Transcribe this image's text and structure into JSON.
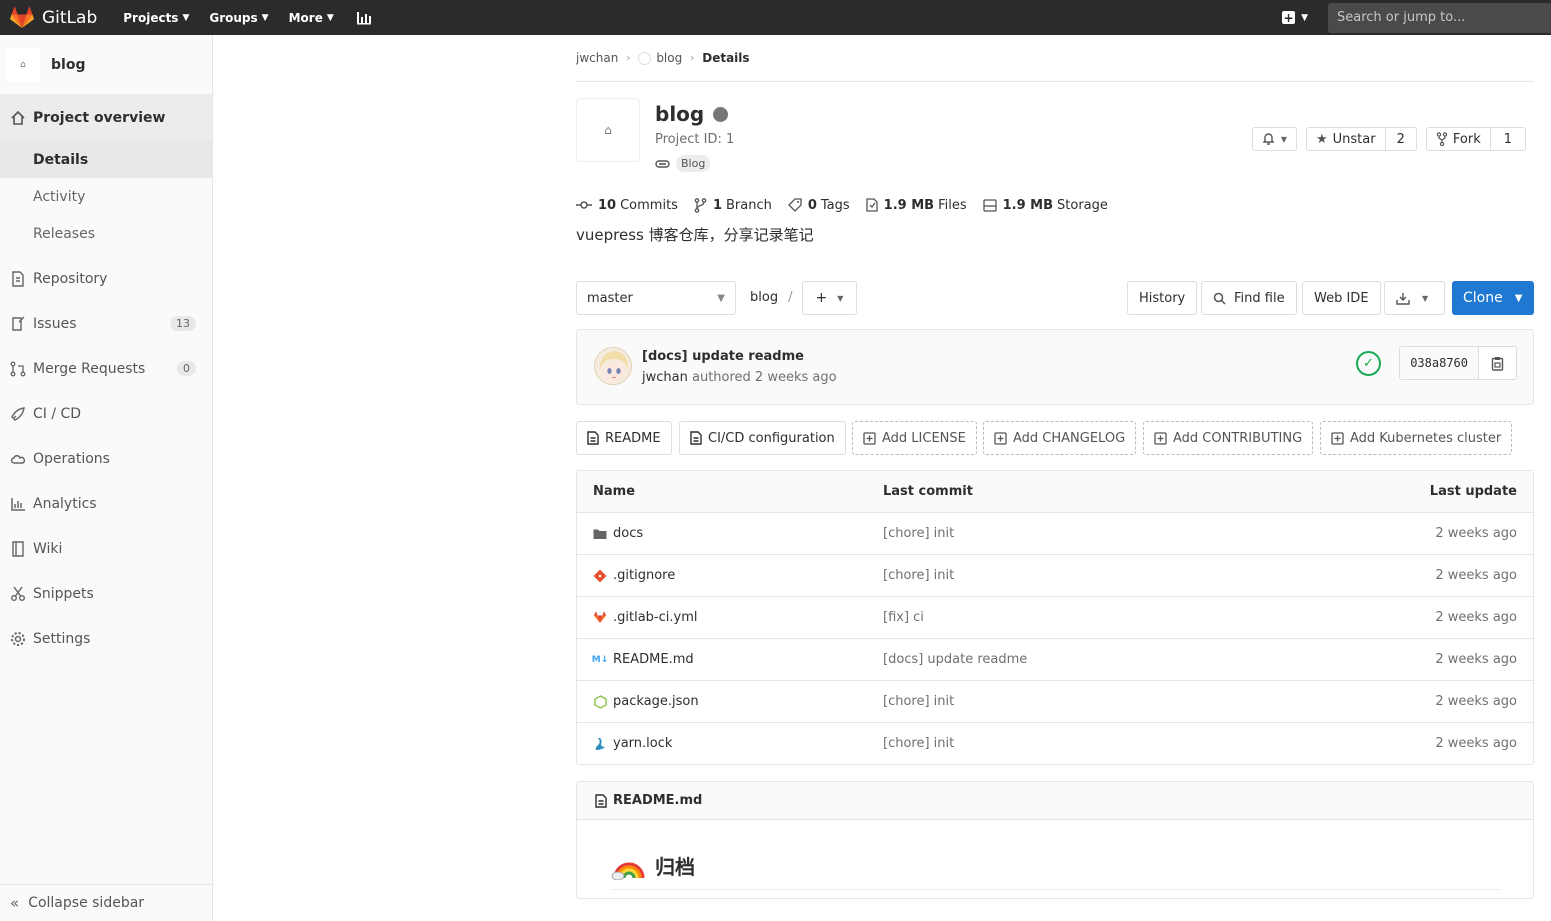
{
  "navbar": {
    "logo": "GitLab",
    "items": [
      {
        "label": "Projects"
      },
      {
        "label": "Groups"
      },
      {
        "label": "More"
      }
    ],
    "search_placeholder": "Search or jump to..."
  },
  "sidebar": {
    "project_avatar_text": "⌂",
    "project_name": "blog",
    "overview": "Project overview",
    "subitems": [
      "Details",
      "Activity",
      "Releases"
    ],
    "items": [
      {
        "label": "Repository",
        "icon": "doc-icon"
      },
      {
        "label": "Issues",
        "icon": "issues-icon",
        "count": "13"
      },
      {
        "label": "Merge Requests",
        "icon": "merge-icon",
        "count": "0"
      },
      {
        "label": "CI / CD",
        "icon": "rocket-icon"
      },
      {
        "label": "Operations",
        "icon": "cloud-icon"
      },
      {
        "label": "Analytics",
        "icon": "chart-icon"
      },
      {
        "label": "Wiki",
        "icon": "book-icon"
      },
      {
        "label": "Snippets",
        "icon": "scissors-icon"
      },
      {
        "label": "Settings",
        "icon": "gear-icon"
      }
    ],
    "collapse": "Collapse sidebar"
  },
  "breadcrumb": {
    "user": "jwchan",
    "project": "blog",
    "current": "Details"
  },
  "project": {
    "name": "blog",
    "id_text": "Project ID: 1",
    "topic": "Blog",
    "notify_icon": "bell-icon",
    "unstar_label": "Unstar",
    "star_count": "2",
    "fork_label": "Fork",
    "fork_count": "1",
    "description": "vuepress 博客仓库，分享记录笔记"
  },
  "stats": [
    {
      "value": "10",
      "label": "Commits"
    },
    {
      "value": "1",
      "label": "Branch"
    },
    {
      "value": "0",
      "label": "Tags"
    },
    {
      "value": "1.9 MB",
      "label": "Files"
    },
    {
      "value": "1.9 MB",
      "label": "Storage"
    }
  ],
  "toolbar": {
    "branch": "master",
    "path": "blog",
    "history": "History",
    "find_file": "Find file",
    "web_ide": "Web IDE",
    "clone": "Clone"
  },
  "last_commit": {
    "title": "[docs] update readme",
    "author": "jwchan",
    "meta": "authored 2 weeks ago",
    "sha": "038a8760",
    "status": "passed",
    "status_color": "#1aaa55"
  },
  "quick_actions": [
    {
      "label": "README",
      "dashed": false
    },
    {
      "label": "CI/CD configuration",
      "dashed": false
    },
    {
      "label": "Add LICENSE",
      "dashed": true
    },
    {
      "label": "Add CHANGELOG",
      "dashed": true
    },
    {
      "label": "Add CONTRIBUTING",
      "dashed": true
    },
    {
      "label": "Add Kubernetes cluster",
      "dashed": true
    }
  ],
  "file_table": {
    "headers": {
      "name": "Name",
      "commit": "Last commit",
      "update": "Last update"
    },
    "rows": [
      {
        "name": "docs",
        "icon": "folder-icon",
        "commit": "[chore] init",
        "update": "2 weeks ago"
      },
      {
        "name": ".gitignore",
        "icon": "git-icon",
        "commit": "[chore] init",
        "update": "2 weeks ago"
      },
      {
        "name": ".gitlab-ci.yml",
        "icon": "gitlab-icon",
        "commit": "[fix] ci",
        "update": "2 weeks ago"
      },
      {
        "name": "README.md",
        "icon": "markdown-icon",
        "commit": "[docs] update readme",
        "update": "2 weeks ago"
      },
      {
        "name": "package.json",
        "icon": "nodejs-icon",
        "commit": "[chore] init",
        "update": "2 weeks ago"
      },
      {
        "name": "yarn.lock",
        "icon": "yarn-icon",
        "commit": "[chore] init",
        "update": "2 weeks ago"
      }
    ]
  },
  "readme": {
    "file": "README.md",
    "heading": "归档"
  },
  "colors": {
    "navbar": "#2b2b2b",
    "primary": "#1f78d1",
    "success": "#1aaa55"
  }
}
